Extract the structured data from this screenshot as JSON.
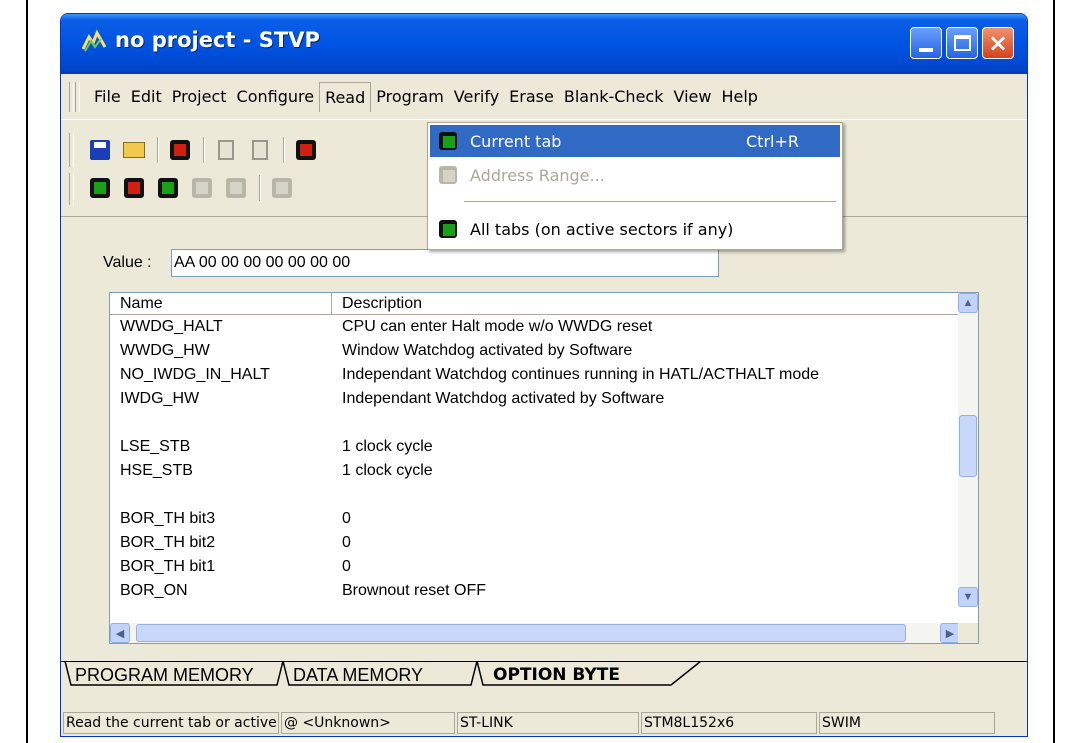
{
  "window": {
    "title": "no project - STVP",
    "close_glyph": "×"
  },
  "menubar": {
    "items": [
      "File",
      "Edit",
      "Project",
      "Configure",
      "Read",
      "Program",
      "Verify",
      "Erase",
      "Blank-Check",
      "View",
      "Help"
    ],
    "open_menu": "Read"
  },
  "dropdown": {
    "items": [
      {
        "label": "Current tab",
        "shortcut": "Ctrl+R",
        "state": "selected"
      },
      {
        "label": "Address Range...",
        "shortcut": "",
        "state": "disabled"
      },
      {
        "label": "All tabs (on active sectors if any)",
        "shortcut": "",
        "state": "normal"
      }
    ]
  },
  "toolbar": {
    "icons_row1": [
      "save-icon",
      "open-icon",
      "chip-icon",
      "copy-icon",
      "paste-icon",
      "chip-read-icon"
    ],
    "icons_row2": [
      "read-icon",
      "program-icon",
      "verify-icon",
      "erase-icon",
      "blank-check-icon",
      "chip-icon"
    ]
  },
  "value_field": {
    "label": "Value :",
    "value": "AA 00 00 00 00 00 00 00"
  },
  "list": {
    "headers": {
      "name": "Name",
      "description": "Description"
    },
    "rows": [
      {
        "name": "WWDG_HALT",
        "description": "CPU can enter Halt mode w/o WWDG reset"
      },
      {
        "name": "WWDG_HW",
        "description": "Window Watchdog activated by Software"
      },
      {
        "name": "NO_IWDG_IN_HALT",
        "description": "Independant Watchdog continues running in HATL/ACTHALT mode"
      },
      {
        "name": "IWDG_HW",
        "description": "Independant Watchdog activated by Software"
      },
      {
        "name": "",
        "description": ""
      },
      {
        "name": "LSE_STB",
        "description": "1 clock cycle"
      },
      {
        "name": "HSE_STB",
        "description": "1 clock cycle"
      },
      {
        "name": "",
        "description": ""
      },
      {
        "name": "BOR_TH bit3",
        "description": "0"
      },
      {
        "name": "BOR_TH bit2",
        "description": "0"
      },
      {
        "name": "BOR_TH bit1",
        "description": "0"
      },
      {
        "name": "BOR_ON",
        "description": "Brownout reset OFF"
      }
    ]
  },
  "tabs": [
    {
      "label": "PROGRAM MEMORY",
      "active": false
    },
    {
      "label": "DATA MEMORY",
      "active": false
    },
    {
      "label": "OPTION BYTE",
      "active": true
    }
  ],
  "statusbar": {
    "panes": [
      "Read the current tab or active sectors",
      "@ <Unknown>",
      "ST-LINK",
      "STM8L152x6",
      "SWIM",
      ""
    ]
  },
  "colors": {
    "titlebar": "#0054e3",
    "selection": "#316ac5",
    "face": "#ece9d8"
  }
}
